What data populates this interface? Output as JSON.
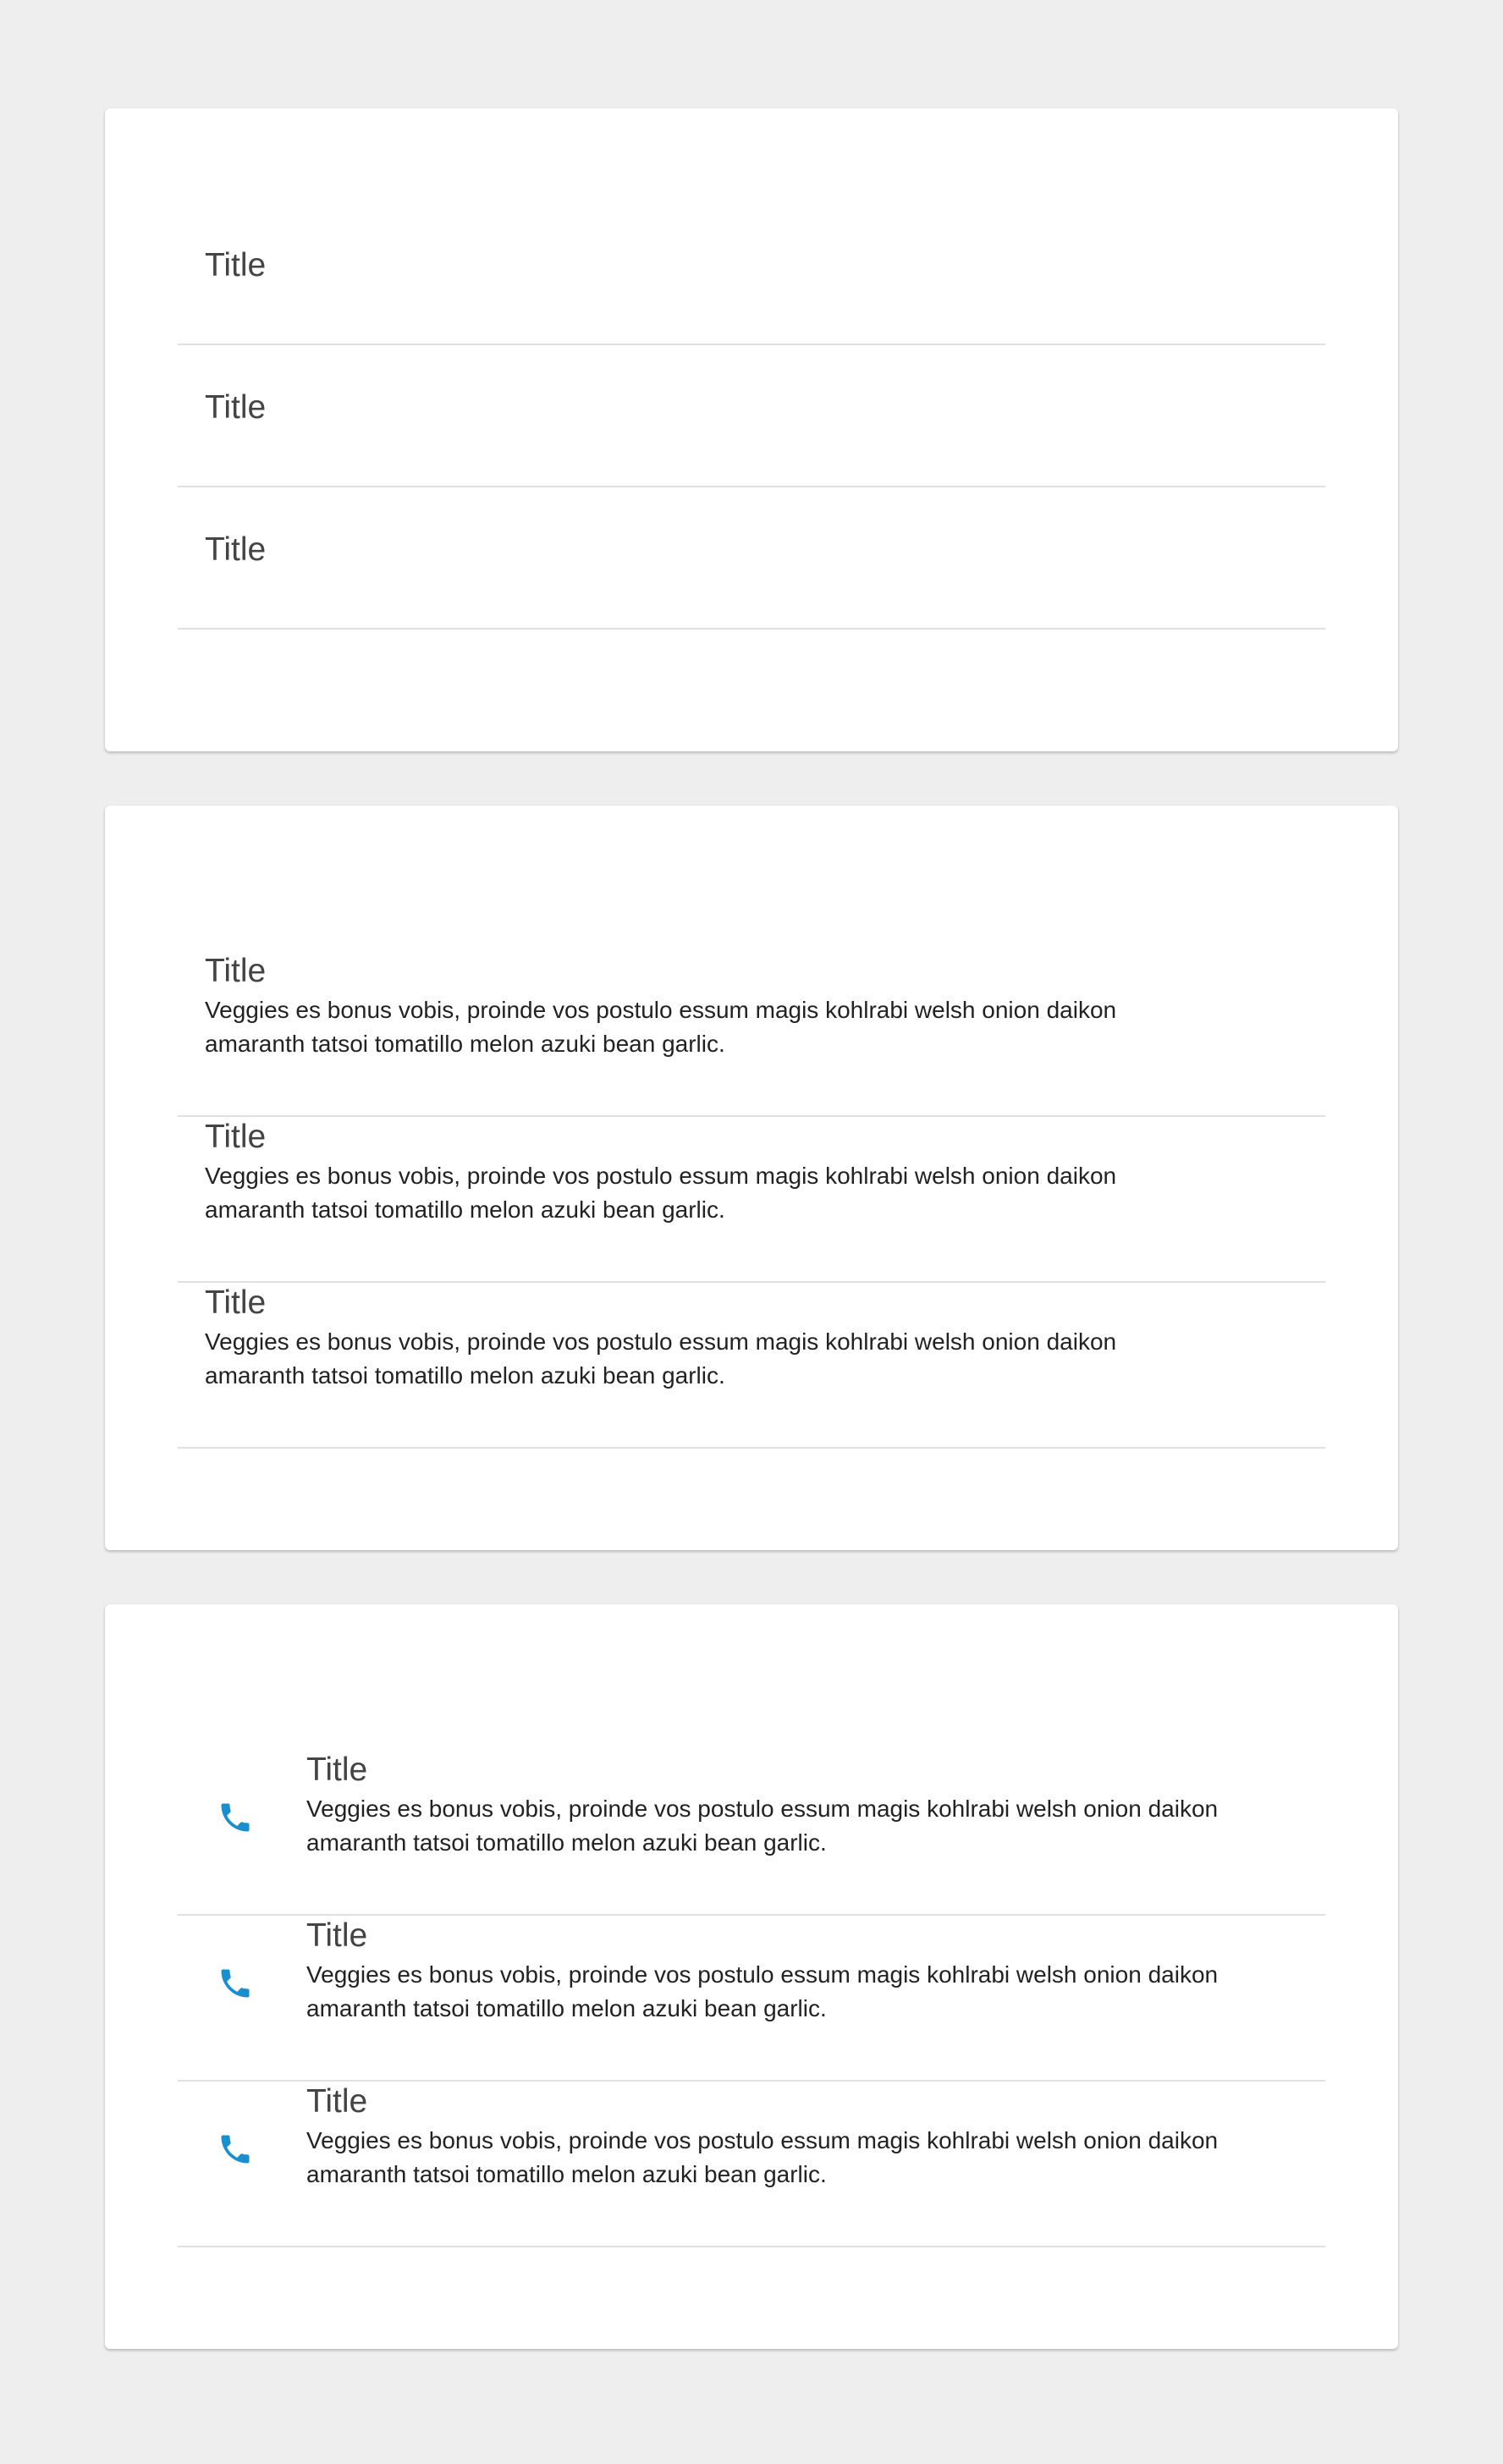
{
  "accent_color": "#1a8fd0",
  "simple_list": {
    "items": [
      {
        "title": "Title"
      },
      {
        "title": "Title"
      },
      {
        "title": "Title"
      }
    ]
  },
  "two_line_list": {
    "items": [
      {
        "title": "Title",
        "body": "Veggies es bonus vobis, proinde vos postulo essum magis kohlrabi welsh onion daikon amaranth tatsoi tomatillo melon azuki bean garlic."
      },
      {
        "title": "Title",
        "body": "Veggies es bonus vobis, proinde vos postulo essum magis kohlrabi welsh onion daikon amaranth tatsoi tomatillo melon azuki bean garlic."
      },
      {
        "title": "Title",
        "body": "Veggies es bonus vobis, proinde vos postulo essum magis kohlrabi welsh onion daikon amaranth tatsoi tomatillo melon azuki bean garlic."
      }
    ]
  },
  "icon_list": {
    "items": [
      {
        "icon": "phone-icon",
        "title": "Title",
        "body": "Veggies es bonus vobis, proinde vos postulo essum magis kohlrabi welsh onion daikon amaranth tatsoi tomatillo melon azuki bean garlic."
      },
      {
        "icon": "phone-icon",
        "title": "Title",
        "body": "Veggies es bonus vobis, proinde vos postulo essum magis kohlrabi welsh onion daikon amaranth tatsoi tomatillo melon azuki bean garlic."
      },
      {
        "icon": "phone-icon",
        "title": "Title",
        "body": "Veggies es bonus vobis, proinde vos postulo essum magis kohlrabi welsh onion daikon amaranth tatsoi tomatillo melon azuki bean garlic."
      }
    ]
  }
}
